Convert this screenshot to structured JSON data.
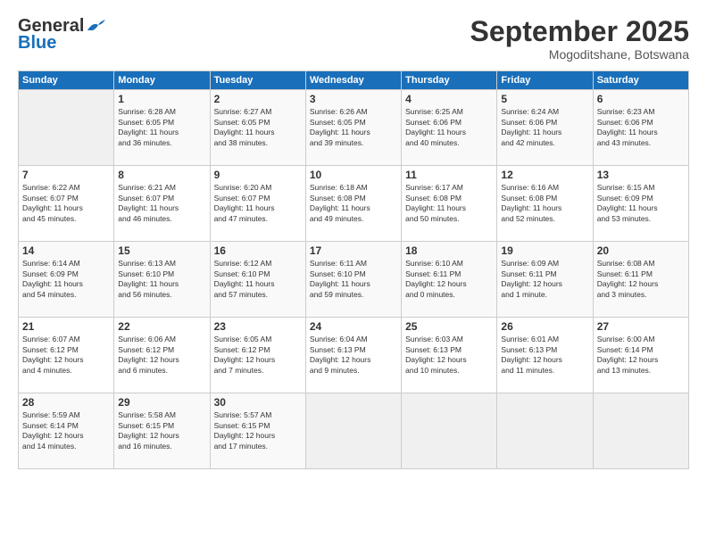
{
  "header": {
    "logo_general": "General",
    "logo_blue": "Blue",
    "month_title": "September 2025",
    "location": "Mogoditshane, Botswana"
  },
  "days_of_week": [
    "Sunday",
    "Monday",
    "Tuesday",
    "Wednesday",
    "Thursday",
    "Friday",
    "Saturday"
  ],
  "weeks": [
    [
      {
        "day": "",
        "info": ""
      },
      {
        "day": "1",
        "info": "Sunrise: 6:28 AM\nSunset: 6:05 PM\nDaylight: 11 hours\nand 36 minutes."
      },
      {
        "day": "2",
        "info": "Sunrise: 6:27 AM\nSunset: 6:05 PM\nDaylight: 11 hours\nand 38 minutes."
      },
      {
        "day": "3",
        "info": "Sunrise: 6:26 AM\nSunset: 6:05 PM\nDaylight: 11 hours\nand 39 minutes."
      },
      {
        "day": "4",
        "info": "Sunrise: 6:25 AM\nSunset: 6:06 PM\nDaylight: 11 hours\nand 40 minutes."
      },
      {
        "day": "5",
        "info": "Sunrise: 6:24 AM\nSunset: 6:06 PM\nDaylight: 11 hours\nand 42 minutes."
      },
      {
        "day": "6",
        "info": "Sunrise: 6:23 AM\nSunset: 6:06 PM\nDaylight: 11 hours\nand 43 minutes."
      }
    ],
    [
      {
        "day": "7",
        "info": "Sunrise: 6:22 AM\nSunset: 6:07 PM\nDaylight: 11 hours\nand 45 minutes."
      },
      {
        "day": "8",
        "info": "Sunrise: 6:21 AM\nSunset: 6:07 PM\nDaylight: 11 hours\nand 46 minutes."
      },
      {
        "day": "9",
        "info": "Sunrise: 6:20 AM\nSunset: 6:07 PM\nDaylight: 11 hours\nand 47 minutes."
      },
      {
        "day": "10",
        "info": "Sunrise: 6:18 AM\nSunset: 6:08 PM\nDaylight: 11 hours\nand 49 minutes."
      },
      {
        "day": "11",
        "info": "Sunrise: 6:17 AM\nSunset: 6:08 PM\nDaylight: 11 hours\nand 50 minutes."
      },
      {
        "day": "12",
        "info": "Sunrise: 6:16 AM\nSunset: 6:08 PM\nDaylight: 11 hours\nand 52 minutes."
      },
      {
        "day": "13",
        "info": "Sunrise: 6:15 AM\nSunset: 6:09 PM\nDaylight: 11 hours\nand 53 minutes."
      }
    ],
    [
      {
        "day": "14",
        "info": "Sunrise: 6:14 AM\nSunset: 6:09 PM\nDaylight: 11 hours\nand 54 minutes."
      },
      {
        "day": "15",
        "info": "Sunrise: 6:13 AM\nSunset: 6:10 PM\nDaylight: 11 hours\nand 56 minutes."
      },
      {
        "day": "16",
        "info": "Sunrise: 6:12 AM\nSunset: 6:10 PM\nDaylight: 11 hours\nand 57 minutes."
      },
      {
        "day": "17",
        "info": "Sunrise: 6:11 AM\nSunset: 6:10 PM\nDaylight: 11 hours\nand 59 minutes."
      },
      {
        "day": "18",
        "info": "Sunrise: 6:10 AM\nSunset: 6:11 PM\nDaylight: 12 hours\nand 0 minutes."
      },
      {
        "day": "19",
        "info": "Sunrise: 6:09 AM\nSunset: 6:11 PM\nDaylight: 12 hours\nand 1 minute."
      },
      {
        "day": "20",
        "info": "Sunrise: 6:08 AM\nSunset: 6:11 PM\nDaylight: 12 hours\nand 3 minutes."
      }
    ],
    [
      {
        "day": "21",
        "info": "Sunrise: 6:07 AM\nSunset: 6:12 PM\nDaylight: 12 hours\nand 4 minutes."
      },
      {
        "day": "22",
        "info": "Sunrise: 6:06 AM\nSunset: 6:12 PM\nDaylight: 12 hours\nand 6 minutes."
      },
      {
        "day": "23",
        "info": "Sunrise: 6:05 AM\nSunset: 6:12 PM\nDaylight: 12 hours\nand 7 minutes."
      },
      {
        "day": "24",
        "info": "Sunrise: 6:04 AM\nSunset: 6:13 PM\nDaylight: 12 hours\nand 9 minutes."
      },
      {
        "day": "25",
        "info": "Sunrise: 6:03 AM\nSunset: 6:13 PM\nDaylight: 12 hours\nand 10 minutes."
      },
      {
        "day": "26",
        "info": "Sunrise: 6:01 AM\nSunset: 6:13 PM\nDaylight: 12 hours\nand 11 minutes."
      },
      {
        "day": "27",
        "info": "Sunrise: 6:00 AM\nSunset: 6:14 PM\nDaylight: 12 hours\nand 13 minutes."
      }
    ],
    [
      {
        "day": "28",
        "info": "Sunrise: 5:59 AM\nSunset: 6:14 PM\nDaylight: 12 hours\nand 14 minutes."
      },
      {
        "day": "29",
        "info": "Sunrise: 5:58 AM\nSunset: 6:15 PM\nDaylight: 12 hours\nand 16 minutes."
      },
      {
        "day": "30",
        "info": "Sunrise: 5:57 AM\nSunset: 6:15 PM\nDaylight: 12 hours\nand 17 minutes."
      },
      {
        "day": "",
        "info": ""
      },
      {
        "day": "",
        "info": ""
      },
      {
        "day": "",
        "info": ""
      },
      {
        "day": "",
        "info": ""
      }
    ]
  ]
}
